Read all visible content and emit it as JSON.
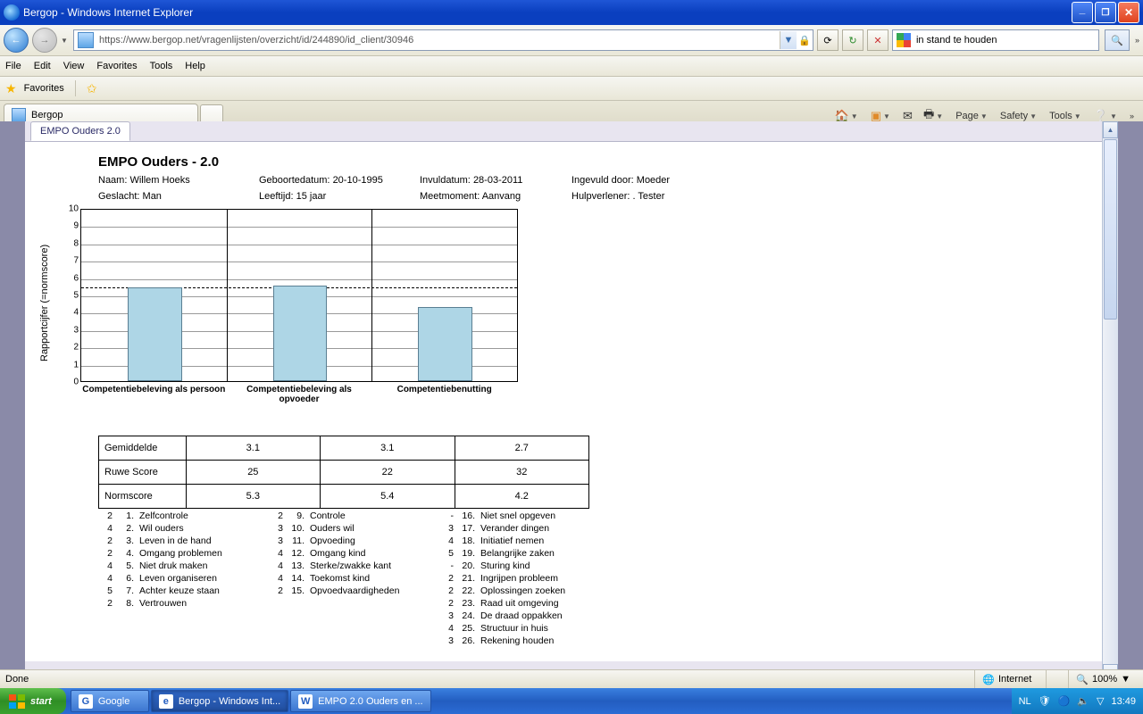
{
  "titlebar": {
    "title": "Bergop - Windows Internet Explorer"
  },
  "nav": {
    "url": "https://www.bergop.net/vragenlijsten/overzicht/id/244890/id_client/30946",
    "search_value": "in stand te houden"
  },
  "menu": {
    "file": "File",
    "edit": "Edit",
    "view": "View",
    "favorites": "Favorites",
    "tools": "Tools",
    "help": "Help"
  },
  "favbar": {
    "label": "Favorites"
  },
  "tab": {
    "label": "Bergop"
  },
  "cmdbar": {
    "page": "Page",
    "safety": "Safety",
    "tools": "Tools"
  },
  "report_tab": "EMPO Ouders 2.0",
  "report": {
    "title": "EMPO Ouders - 2.0",
    "naam_label": "Naam:",
    "naam": "Willem Hoeks",
    "geboortedatum_label": "Geboortedatum:",
    "geboortedatum": "20-10-1995",
    "invuldatum_label": "Invuldatum:",
    "invuldatum": "28-03-2011",
    "ingevuld_label": "Ingevuld door:",
    "ingevuld": "Moeder",
    "geslacht_label": "Geslacht:",
    "geslacht": "Man",
    "leeftijd_label": "Leeftijd:",
    "leeftijd": "15 jaar",
    "meetmoment_label": "Meetmoment:",
    "meetmoment": "Aanvang",
    "hulpverlener_label": "Hulpverlener:",
    "hulpverlener": ". Tester"
  },
  "chart_data": {
    "type": "bar",
    "ylabel": "Rapportcijfer (=normscore)",
    "ylim": [
      0,
      10
    ],
    "reference_line": 5.5,
    "categories": [
      "Competentiebeleving als persoon",
      "Competentiebeleving als opvoeder",
      "Competentiebenutting"
    ],
    "values": [
      5.3,
      5.4,
      4.2
    ]
  },
  "table": {
    "rows": [
      {
        "label": "Gemiddelde",
        "v": [
          "3.1",
          "3.1",
          "2.7"
        ]
      },
      {
        "label": "Ruwe Score",
        "v": [
          "25",
          "22",
          "32"
        ]
      },
      {
        "label": "Normscore",
        "v": [
          "5.3",
          "5.4",
          "4.2"
        ]
      }
    ]
  },
  "items": {
    "col1": [
      {
        "sc": "2",
        "nr": "1.",
        "txt": "Zelfcontrole"
      },
      {
        "sc": "4",
        "nr": "2.",
        "txt": "Wil ouders"
      },
      {
        "sc": "2",
        "nr": "3.",
        "txt": "Leven in de hand"
      },
      {
        "sc": "2",
        "nr": "4.",
        "txt": "Omgang problemen"
      },
      {
        "sc": "4",
        "nr": "5.",
        "txt": "Niet druk maken"
      },
      {
        "sc": "4",
        "nr": "6.",
        "txt": "Leven organiseren"
      },
      {
        "sc": "5",
        "nr": "7.",
        "txt": "Achter keuze staan"
      },
      {
        "sc": "2",
        "nr": "8.",
        "txt": "Vertrouwen"
      }
    ],
    "col2": [
      {
        "sc": "2",
        "nr": "9.",
        "txt": "Controle"
      },
      {
        "sc": "3",
        "nr": "10.",
        "txt": "Ouders wil"
      },
      {
        "sc": "3",
        "nr": "11.",
        "txt": "Opvoeding"
      },
      {
        "sc": "4",
        "nr": "12.",
        "txt": "Omgang kind"
      },
      {
        "sc": "4",
        "nr": "13.",
        "txt": "Sterke/zwakke kant"
      },
      {
        "sc": "4",
        "nr": "14.",
        "txt": "Toekomst kind"
      },
      {
        "sc": "2",
        "nr": "15.",
        "txt": "Opvoedvaardigheden"
      }
    ],
    "col3": [
      {
        "sc": "-",
        "nr": "16.",
        "txt": "Niet snel opgeven"
      },
      {
        "sc": "3",
        "nr": "17.",
        "txt": "Verander dingen"
      },
      {
        "sc": "4",
        "nr": "18.",
        "txt": "Initiatief nemen"
      },
      {
        "sc": "5",
        "nr": "19.",
        "txt": "Belangrijke zaken"
      },
      {
        "sc": "-",
        "nr": "20.",
        "txt": "Sturing kind"
      },
      {
        "sc": "2",
        "nr": "21.",
        "txt": "Ingrijpen probleem"
      },
      {
        "sc": "2",
        "nr": "22.",
        "txt": "Oplossingen zoeken"
      },
      {
        "sc": "2",
        "nr": "23.",
        "txt": "Raad uit omgeving"
      },
      {
        "sc": "3",
        "nr": "24.",
        "txt": "De draad oppakken"
      },
      {
        "sc": "4",
        "nr": "25.",
        "txt": "Structuur in huis"
      },
      {
        "sc": "3",
        "nr": "26.",
        "txt": "Rekening houden"
      }
    ]
  },
  "status": {
    "done": "Done",
    "zone": "Internet",
    "zoom": "100%"
  },
  "taskbar": {
    "start": "start",
    "buttons": [
      {
        "label": "Google"
      },
      {
        "label": "Bergop - Windows Int..."
      },
      {
        "label": "EMPO 2.0 Ouders en ..."
      }
    ],
    "lang": "NL",
    "clock": "13:49"
  }
}
